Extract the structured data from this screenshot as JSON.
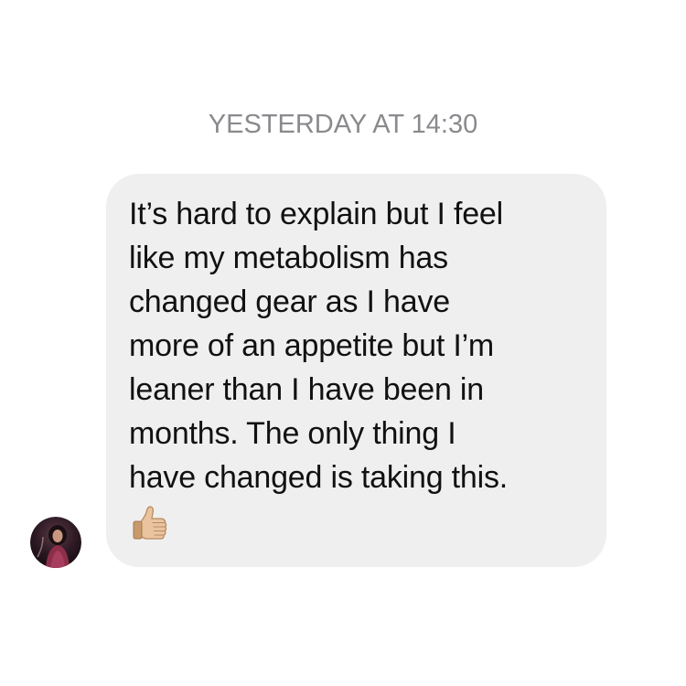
{
  "thread": {
    "timestamp": "YESTERDAY AT 14:30"
  },
  "message": {
    "text": "It’s hard to explain but I feel\nlike my metabolism has\nchanged gear as I have\nmore of an appetite but I’m\nleaner than I have been in\nmonths. The only thing I\nhave changed is taking this.",
    "emoji_icon": "thumbs-up-icon",
    "bubble_color": "#efefef"
  },
  "sender": {
    "avatar_icon": "avatar"
  }
}
